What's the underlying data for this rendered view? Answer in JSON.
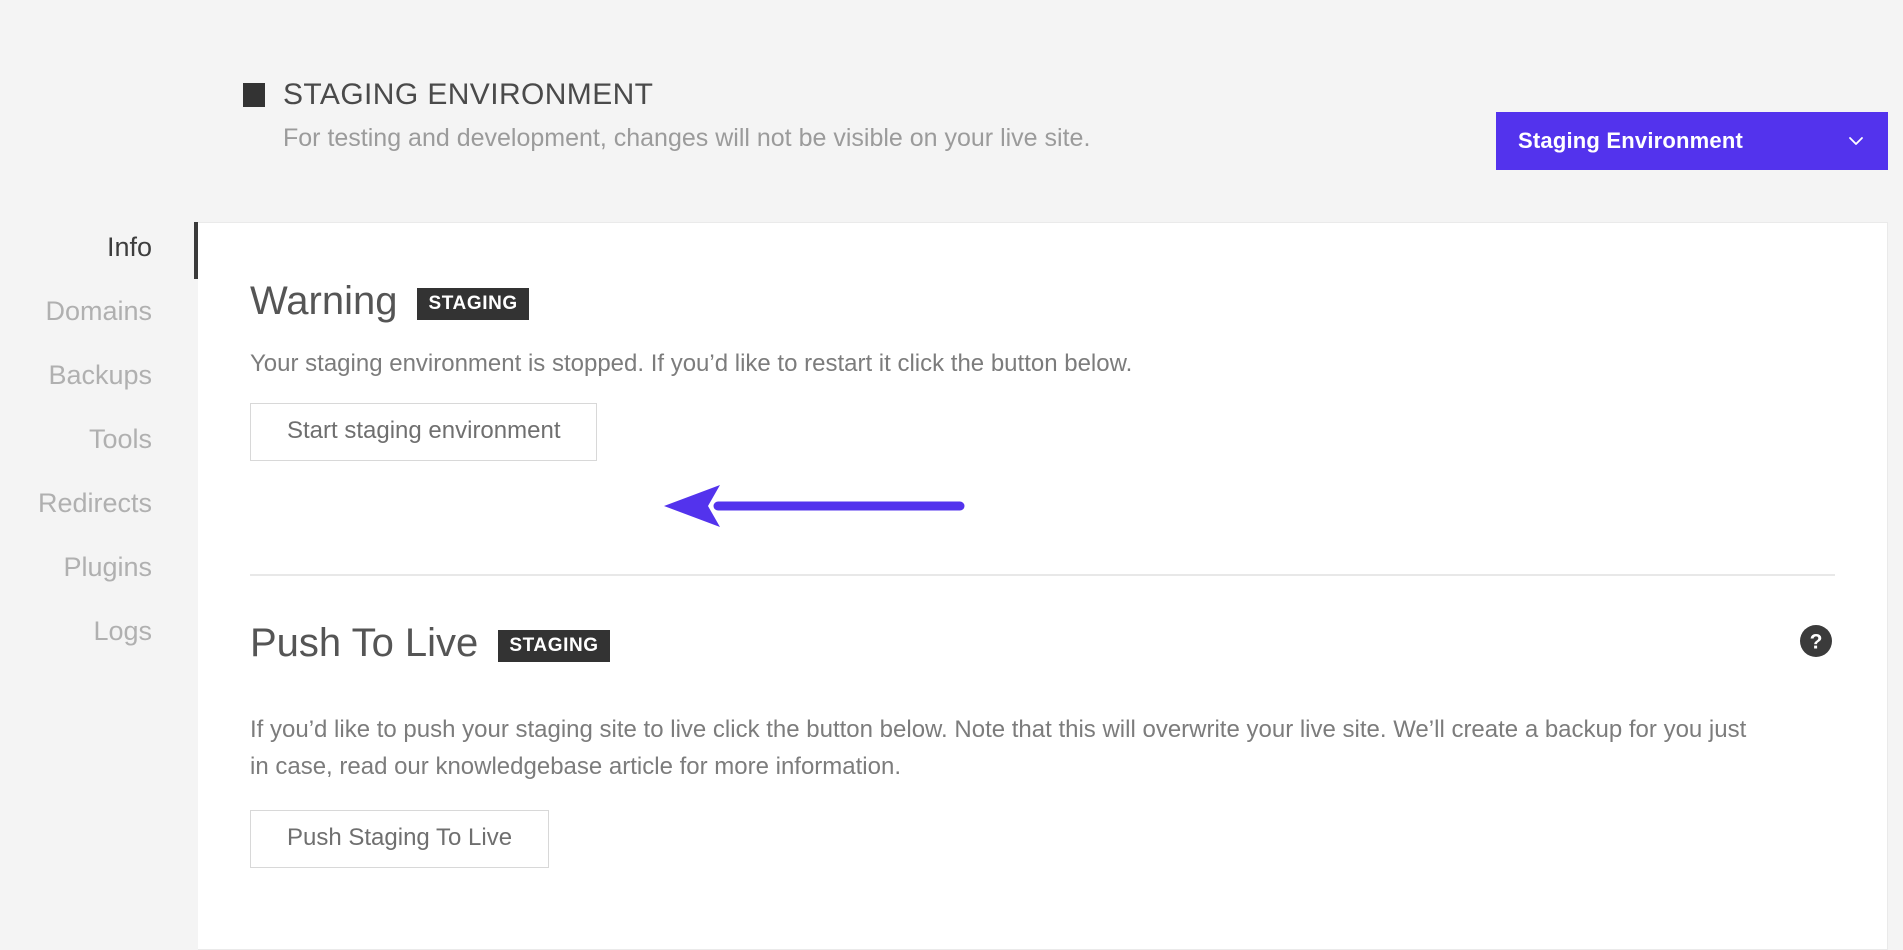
{
  "header": {
    "icon": "filled-square-icon",
    "title": "STAGING ENVIRONMENT",
    "subtitle": "For testing and development, changes will not be visible on your live site."
  },
  "env_dropdown": {
    "label": "Staging Environment",
    "icon": "chevron-down-icon",
    "background_color": "#5333ed",
    "text_color": "#ffffff"
  },
  "sidebar": {
    "items": [
      {
        "label": "Info",
        "active": true
      },
      {
        "label": "Domains",
        "active": false
      },
      {
        "label": "Backups",
        "active": false
      },
      {
        "label": "Tools",
        "active": false
      },
      {
        "label": "Redirects",
        "active": false
      },
      {
        "label": "Plugins",
        "active": false
      },
      {
        "label": "Logs",
        "active": false
      }
    ]
  },
  "sections": {
    "warning": {
      "title": "Warning",
      "badge": "STAGING",
      "text": "Your staging environment is stopped. If you’d like to restart it click the button below.",
      "button_label": "Start staging environment"
    },
    "push_to_live": {
      "title": "Push To Live",
      "badge": "STAGING",
      "help_icon": "question-mark-circle-icon",
      "text": "If you’d like to push your staging site to live click the button below. Note that this will overwrite your live site. We’ll create a backup for you just in case, read our knowledgebase article for more information.",
      "button_label": "Push Staging To Live"
    }
  },
  "annotation": {
    "arrow": "left-pointing-arrow",
    "color": "#5333ed"
  }
}
